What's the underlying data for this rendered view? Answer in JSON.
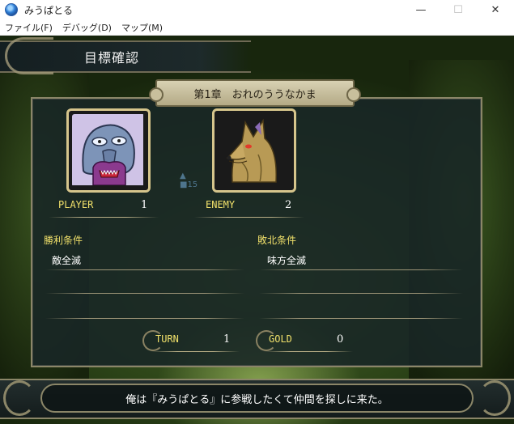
{
  "window": {
    "title": "みうぱとる",
    "controls": {
      "minimize": "—",
      "maximize": "☐",
      "close": "✕"
    }
  },
  "menu": {
    "items": [
      {
        "label": "ファイル(F)"
      },
      {
        "label": "デバッグ(D)"
      },
      {
        "label": "マップ(M)"
      }
    ]
  },
  "screen": {
    "header_title": "目標確認",
    "chapter": "第1章　おれのううなかま",
    "player": {
      "label": "PLAYER",
      "count": "1"
    },
    "enemy": {
      "label": "ENEMY",
      "count": "2"
    },
    "victory": {
      "heading": "勝利条件",
      "condition": "敵全滅"
    },
    "defeat": {
      "heading": "敗北条件",
      "condition": "味方全滅"
    },
    "turn": {
      "label": "TURN",
      "value": "1"
    },
    "gold": {
      "label": "GOLD",
      "value": "0"
    },
    "message": "俺は『みうぱとる』に参戦したくて仲間を探しに来た。"
  }
}
